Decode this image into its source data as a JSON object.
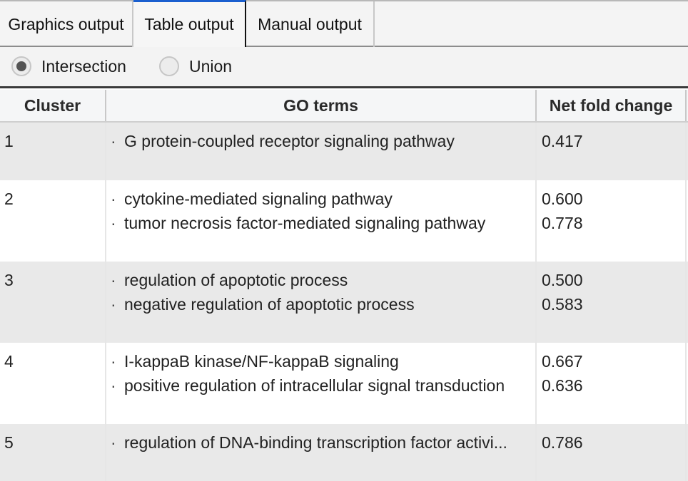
{
  "tabs": [
    {
      "label": "Graphics output",
      "selected": false
    },
    {
      "label": "Table output",
      "selected": true
    },
    {
      "label": "Manual output",
      "selected": false
    }
  ],
  "mode": {
    "options": [
      {
        "label": "Intersection",
        "checked": true
      },
      {
        "label": "Union",
        "checked": false
      }
    ]
  },
  "table": {
    "columns": [
      "Cluster",
      "GO terms",
      "Net fold change"
    ],
    "bullet": "·",
    "rows": [
      {
        "cluster": "1",
        "terms": [
          "G protein-coupled receptor signaling pathway"
        ],
        "values": [
          "0.417"
        ]
      },
      {
        "cluster": "2",
        "terms": [
          "cytokine-mediated signaling pathway",
          "tumor necrosis factor-mediated signaling pathway"
        ],
        "values": [
          "0.600",
          "0.778"
        ]
      },
      {
        "cluster": "3",
        "terms": [
          "regulation of apoptotic process",
          "negative regulation of apoptotic process"
        ],
        "values": [
          "0.500",
          "0.583"
        ]
      },
      {
        "cluster": "4",
        "terms": [
          "I-kappaB kinase/NF-kappaB signaling",
          "positive regulation of intracellular signal transduction"
        ],
        "values": [
          "0.667",
          "0.636"
        ]
      },
      {
        "cluster": "5",
        "terms": [
          "regulation of DNA-binding transcription factor activi..."
        ],
        "values": [
          "0.786"
        ]
      }
    ]
  },
  "colors": {
    "selected_tab_accent": "#1a5fcf",
    "row_alt": "#e9e9e9",
    "row": "#ffffff"
  }
}
